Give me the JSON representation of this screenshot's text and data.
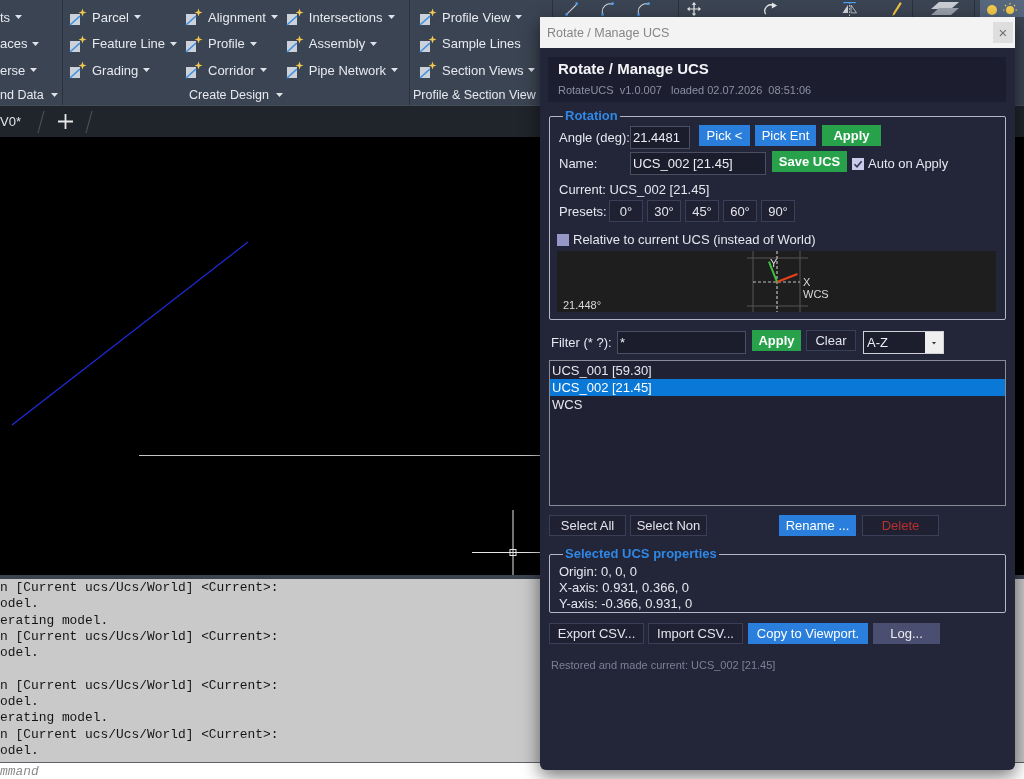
{
  "ribbon": {
    "panels": [
      {
        "title": "nd Data",
        "title_dropdown": true,
        "cut_off": true,
        "columns": [
          [
            {
              "label": "ts",
              "dropdown": true
            },
            {
              "label": "aces",
              "dropdown": true
            },
            {
              "label": "erse",
              "dropdown": true
            }
          ]
        ]
      },
      {
        "title": "Create Design",
        "title_dropdown": true,
        "cut_off": false,
        "columns": [
          [
            {
              "label": "Parcel",
              "dropdown": true
            },
            {
              "label": "Feature Line",
              "dropdown": true
            },
            {
              "label": "Grading",
              "dropdown": true
            }
          ],
          [
            {
              "label": "Alignment",
              "dropdown": true
            },
            {
              "label": "Profile",
              "dropdown": true
            },
            {
              "label": "Corridor",
              "dropdown": true
            }
          ],
          [
            {
              "label": "Intersections",
              "dropdown": true
            },
            {
              "label": "Assembly",
              "dropdown": true
            },
            {
              "label": "Pipe Network",
              "dropdown": true
            }
          ]
        ]
      },
      {
        "title": "Profile & Section View",
        "title_dropdown": false,
        "cut_off": false,
        "columns": [
          [
            {
              "label": "Profile View",
              "dropdown": true
            },
            {
              "label": "Sample Lines",
              "dropdown": false
            },
            {
              "label": "Section Views",
              "dropdown": true
            }
          ]
        ]
      }
    ]
  },
  "file_tabs": [
    {
      "label": "V0*"
    }
  ],
  "command_history": [
    {
      "lines": [
        "n [Current ucs/Ucs/World] <Current>:",
        "odel.",
        "erating model.",
        "n [Current ucs/Ucs/World] <Current>:",
        "odel."
      ]
    },
    {
      "lines": [
        "n [Current ucs/Ucs/World] <Current>:",
        "odel.",
        "erating model.",
        "n [Current ucs/Ucs/World] <Current>:",
        "odel."
      ]
    }
  ],
  "command_line": {
    "placeholder": "mmand"
  },
  "dialog": {
    "title": "Rotate / Manage UCS",
    "close_label": "×",
    "header": {
      "title": "Rotate / Manage UCS",
      "subtitle": "RotateUCS  v1.0.007   loaded 02.07.2026  08:51:06"
    },
    "rotation": {
      "legend": "Rotation",
      "angle_label": "Angle (deg):",
      "angle_value": "21.4481",
      "angle_buttons": [
        {
          "label": "Pick <",
          "kind": "primary"
        },
        {
          "label": "Pick Ent",
          "kind": "primary"
        },
        {
          "label": "Apply",
          "kind": "success"
        }
      ],
      "name_label": "Name:",
      "name_value": "UCS_002 [21.45]",
      "save_button": {
        "label": "Save UCS",
        "kind": "success"
      },
      "auto_apply": {
        "label": "Auto on Apply",
        "checked": true
      },
      "current": "Current: UCS_002 [21.45]",
      "presets_label": "Presets:",
      "presets": [
        "0°",
        "30°",
        "45°",
        "60°",
        "90°"
      ],
      "relative": {
        "label": "Relative to current UCS (instead of World)",
        "checked": false
      },
      "preview": {
        "x_label": "X",
        "y_label": "Y",
        "origin_label": "WCS",
        "angle_label": "21.448°"
      }
    },
    "filter": {
      "label": "Filter (* ?):",
      "value": "*",
      "buttons": [
        {
          "label": "Apply",
          "kind": "success"
        },
        {
          "label": "Clear",
          "kind": "outline"
        }
      ],
      "sort": "A-Z"
    },
    "ucs_list": [
      {
        "label": "UCS_001 [59.30]",
        "selected": false
      },
      {
        "label": "UCS_002 [21.45]",
        "selected": true
      },
      {
        "label": "WCS",
        "selected": false
      }
    ],
    "selection_buttons": [
      {
        "label": "Select All",
        "kind": "outline"
      },
      {
        "label": "Select Non",
        "kind": "outline"
      }
    ],
    "item_buttons": [
      {
        "label": "Rename ...",
        "kind": "primary"
      },
      {
        "label": "Delete",
        "kind": "danger"
      }
    ],
    "properties": {
      "legend": "Selected UCS properties",
      "lines": [
        "Origin: 0, 0, 0",
        "X-axis: 0.931, 0.366, 0",
        "Y-axis: -0.366, 0.931, 0"
      ]
    },
    "file_buttons": [
      {
        "label": "Export CSV...",
        "kind": "outline"
      },
      {
        "label": "Import CSV...",
        "kind": "outline"
      },
      {
        "label": "Copy to Viewport.",
        "kind": "primary"
      },
      {
        "label": "Log...",
        "kind": "muted"
      }
    ],
    "status": "Restored and made current: UCS_002 [21.45]"
  }
}
